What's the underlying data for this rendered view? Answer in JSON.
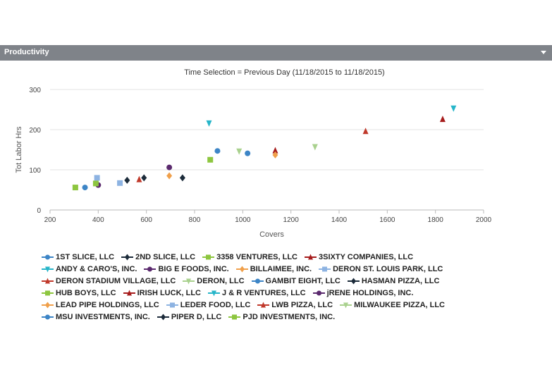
{
  "panel": {
    "title": "Productivity"
  },
  "chart_data": {
    "type": "scatter",
    "title": "Time Selection = Previous Day (11/18/2015 to 11/18/2015)",
    "xlabel": "Covers",
    "ylabel": "Tot Labor Hrs",
    "xlim": [
      200,
      2000
    ],
    "ylim": [
      0,
      300
    ],
    "xticks": [
      200,
      400,
      600,
      800,
      1000,
      1200,
      1400,
      1600,
      1800,
      2000
    ],
    "yticks": [
      0,
      100,
      200,
      300
    ],
    "grid": true,
    "legend_position": "bottom",
    "series": [
      {
        "name": "1ST SLICE, LLC",
        "color": "#3d85c6",
        "marker": "circle",
        "points": [
          [
            895,
            147
          ]
        ]
      },
      {
        "name": "2ND SLICE, LLC",
        "color": "#1c2b3a",
        "marker": "diamond",
        "points": [
          [
            520,
            74
          ]
        ]
      },
      {
        "name": "3358 VENTURES, LLC",
        "color": "#8dc63f",
        "marker": "square",
        "points": [
          [
            865,
            125
          ]
        ]
      },
      {
        "name": "3SIXTY COMPANIES, LLC",
        "color": "#a61c1c",
        "marker": "triangle-up",
        "points": [
          [
            1135,
            148
          ]
        ]
      },
      {
        "name": "ANDY & CARO'S, INC.",
        "color": "#26b5c9",
        "marker": "triangle-down",
        "points": [
          [
            1875,
            253
          ]
        ]
      },
      {
        "name": "BIG E FOODS, INC.",
        "color": "#5b2a6e",
        "marker": "circle",
        "points": [
          [
            400,
            62
          ]
        ]
      },
      {
        "name": "BILLAIMEE, INC.",
        "color": "#f0a04b",
        "marker": "diamond",
        "points": [
          [
            695,
            85
          ]
        ]
      },
      {
        "name": "DERON ST. LOUIS PARK, LLC",
        "color": "#8db3e2",
        "marker": "square",
        "points": [
          [
            395,
            80
          ]
        ]
      },
      {
        "name": "DERON STADIUM VILLAGE, LLC",
        "color": "#c0392b",
        "marker": "triangle-up",
        "points": [
          [
            1510,
            196
          ]
        ]
      },
      {
        "name": "DERON, LLC",
        "color": "#a9d18e",
        "marker": "triangle-down",
        "points": [
          [
            1300,
            157
          ]
        ]
      },
      {
        "name": "GAMBIT EIGHT, LLC",
        "color": "#3d85c6",
        "marker": "circle",
        "points": [
          [
            1020,
            141
          ]
        ]
      },
      {
        "name": "HASMAN PIZZA, LLC",
        "color": "#1c2b3a",
        "marker": "diamond",
        "points": [
          [
            590,
            80
          ]
        ]
      },
      {
        "name": "HUB BOYS, LLC",
        "color": "#8dc63f",
        "marker": "square",
        "points": [
          [
            305,
            56
          ]
        ]
      },
      {
        "name": "IRISH LUCK, LLC",
        "color": "#a61c1c",
        "marker": "triangle-up",
        "points": [
          [
            1830,
            226
          ]
        ]
      },
      {
        "name": "J & R VENTURES, LLC",
        "color": "#26b5c9",
        "marker": "triangle-down",
        "points": [
          [
            860,
            216
          ]
        ]
      },
      {
        "name": "jRENE HOLDINGS, INC.",
        "color": "#5b2a6e",
        "marker": "circle",
        "points": [
          [
            695,
            106
          ]
        ]
      },
      {
        "name": "LEAD PIPE HOLDINGS, LLC",
        "color": "#f0a04b",
        "marker": "diamond",
        "points": [
          [
            1135,
            137
          ]
        ]
      },
      {
        "name": "LEDER FOOD, LLC",
        "color": "#8db3e2",
        "marker": "square",
        "points": [
          [
            490,
            67
          ]
        ]
      },
      {
        "name": "LWB PIZZA, LLC",
        "color": "#c0392b",
        "marker": "triangle-up",
        "points": [
          [
            570,
            76
          ]
        ]
      },
      {
        "name": "MILWAUKEE PIZZA, LLC",
        "color": "#a9d18e",
        "marker": "triangle-down",
        "points": [
          [
            985,
            146
          ]
        ]
      },
      {
        "name": "MSU INVESTMENTS, INC.",
        "color": "#3d85c6",
        "marker": "circle",
        "points": [
          [
            345,
            56
          ]
        ]
      },
      {
        "name": "PIPER D, LLC",
        "color": "#1c2b3a",
        "marker": "diamond",
        "points": [
          [
            750,
            80
          ]
        ]
      },
      {
        "name": "PJD INVESTMENTS, INC.",
        "color": "#8dc63f",
        "marker": "square",
        "points": [
          [
            390,
            66
          ]
        ]
      }
    ]
  },
  "legend_rows": [
    [
      0,
      1,
      2,
      3
    ],
    [
      4,
      5,
      6,
      7
    ],
    [
      8,
      9,
      10,
      11
    ],
    [
      12,
      13,
      14,
      15
    ],
    [
      16,
      17,
      18,
      19
    ],
    [
      20,
      21,
      22
    ]
  ]
}
